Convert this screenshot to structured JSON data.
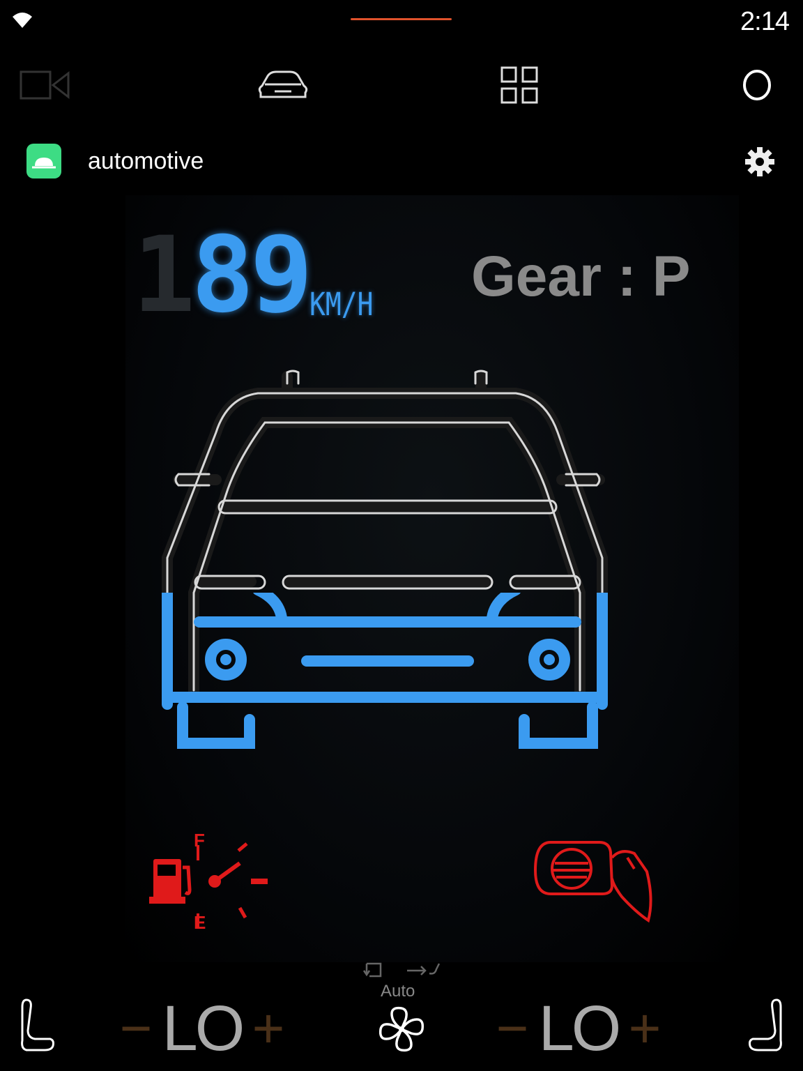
{
  "status": {
    "time": "2:14"
  },
  "nav": {
    "items": [
      "camera-icon",
      "car-icon",
      "app-grid-icon",
      "home-circle-icon"
    ]
  },
  "app": {
    "title": "automotive"
  },
  "dashboard": {
    "speed_ghost": "1",
    "speed_value": "89",
    "speed_unit": "KM/H",
    "gear": "Gear :  P",
    "fuel": {
      "full_label": "F",
      "empty_label": "E"
    },
    "colors": {
      "accent": "#3b9bf0",
      "warning": "#e01a1a",
      "gear": "#8a8a8a"
    }
  },
  "hvac": {
    "auto_label": "Auto",
    "left_temp": "LO",
    "right_temp": "LO",
    "minus_label": "−",
    "plus_label": "+"
  }
}
